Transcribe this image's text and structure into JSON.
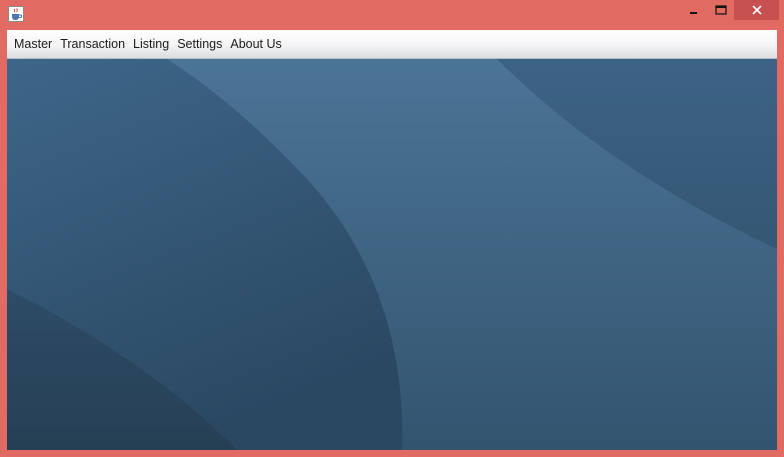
{
  "window": {
    "frame_color": "#e16a63",
    "close_button_color": "#c75050",
    "app_icon": "java-cup-icon"
  },
  "menubar": {
    "items": [
      {
        "label": "Master"
      },
      {
        "label": "Transaction"
      },
      {
        "label": "Listing"
      },
      {
        "label": "Settings"
      },
      {
        "label": "About Us"
      }
    ]
  },
  "desktop": {
    "background": "blue-abstract-wallpaper",
    "colors": [
      "#3f6688",
      "#2b4a63",
      "#4a7090"
    ]
  }
}
